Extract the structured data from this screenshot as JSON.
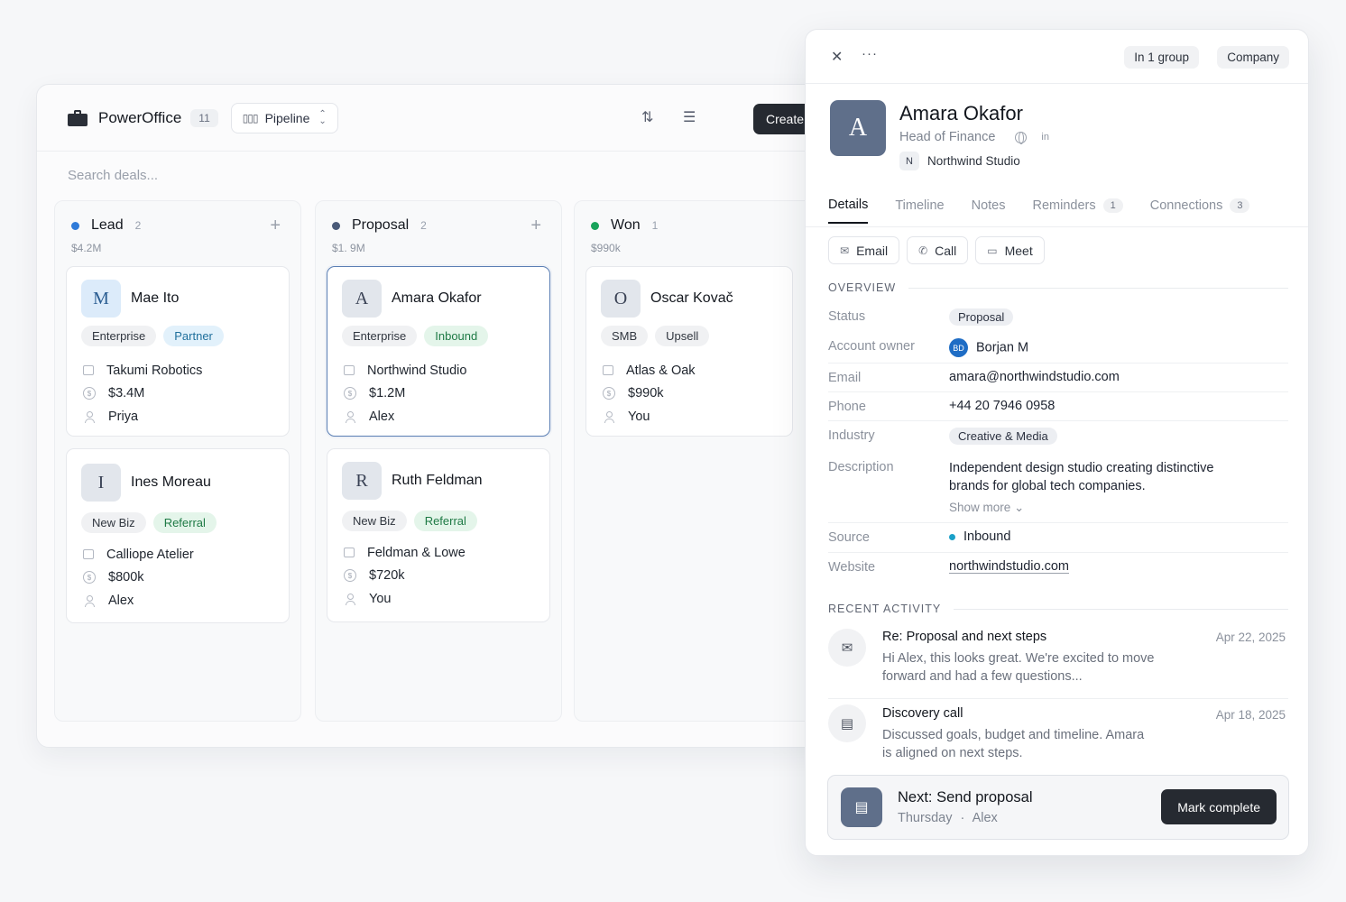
{
  "app": {
    "name": "PowerOffice",
    "count": "11",
    "view": "Pipeline",
    "create_label": "Create",
    "search_placeholder": "Search deals..."
  },
  "columns": [
    {
      "title": "Lead",
      "count": "2",
      "total": "$4.2M",
      "dot_color": "#2f7bd9",
      "cards": [
        {
          "initial": "M",
          "name": "Mae Ito",
          "tags": [
            "Enterprise",
            "Partner"
          ],
          "company": "Takumi Robotics",
          "amount": "$3.4M",
          "owner": "Priya"
        },
        {
          "initial": "I",
          "name": "Ines Moreau",
          "tags": [
            "New Biz",
            "Referral"
          ],
          "company": "Calliope Atelier",
          "amount": "$800k",
          "owner": "Alex"
        }
      ]
    },
    {
      "title": "Proposal",
      "count": "2",
      "total": "$1. 9M",
      "dot_color": "#4a5a78",
      "cards": [
        {
          "initial": "A",
          "name": "Amara Okafor",
          "tags": [
            "Enterprise",
            "Inbound"
          ],
          "company": "Northwind Studio",
          "amount": "$1.2M",
          "owner": "Alex"
        },
        {
          "initial": "R",
          "name": "Ruth Feldman",
          "tags": [
            "New Biz",
            "Referral"
          ],
          "company": "Feldman & Lowe",
          "amount": "$720k",
          "owner": "You"
        }
      ]
    },
    {
      "title": "Won",
      "count": "1",
      "total": "$990k",
      "dot_color": "#19a35b",
      "cards": [
        {
          "initial": "O",
          "name": "Oscar Kovač",
          "tags": [
            "SMB",
            "Upsell"
          ],
          "company": "Atlas & Oak",
          "amount": "$990k",
          "owner": "You"
        }
      ]
    }
  ],
  "panel": {
    "chips": [
      "In 1 group",
      "Company"
    ],
    "contact": {
      "initial": "A",
      "name": "Amara Okafor",
      "role": "Head of Finance",
      "linkedin": "in",
      "company_initial": "N",
      "company": "Northwind Studio"
    },
    "tabs": [
      {
        "label": "Details"
      },
      {
        "label": "Timeline"
      },
      {
        "label": "Notes"
      },
      {
        "label": "Reminders",
        "badge": "1"
      },
      {
        "label": "Connections",
        "badge": "3"
      }
    ],
    "actions": [
      "Email",
      "Call",
      "Meet"
    ],
    "overview_title": "OVERVIEW",
    "fields": {
      "status": {
        "label": "Status",
        "value": "Proposal"
      },
      "owner": {
        "label": "Account owner",
        "initials": "BD",
        "value": "Borjan M"
      },
      "email": {
        "label": "Email",
        "value": "amara@northwindstudio.com"
      },
      "phone": {
        "label": "Phone",
        "value": "+44 20 7946 0958"
      },
      "industry": {
        "label": "Industry",
        "value": "Creative & Media"
      },
      "description": {
        "label": "Description",
        "line1": "Independent design studio creating distinctive",
        "line2": "brands for global tech companies.",
        "show_more": "Show more"
      },
      "source": {
        "label": "Source",
        "value": "Inbound"
      },
      "website": {
        "label": "Website",
        "value": "northwindstudio.com"
      }
    },
    "activity_title": "RECENT ACTIVITY",
    "activity": [
      {
        "title": "Re: Proposal and next steps",
        "date": "Apr 22, 2025",
        "line1": "Hi Alex, this looks great. We're excited to move",
        "line2": "forward and had a few questions..."
      },
      {
        "title": "Discovery call",
        "date": "Apr 18, 2025",
        "line1": "Discussed goals, budget and timeline. Amara",
        "line2": "is aligned on next steps."
      }
    ],
    "next": {
      "title": "Next: Send proposal",
      "day": "Thursday",
      "sep": "·",
      "who": "Alex",
      "button": "Mark complete"
    }
  }
}
